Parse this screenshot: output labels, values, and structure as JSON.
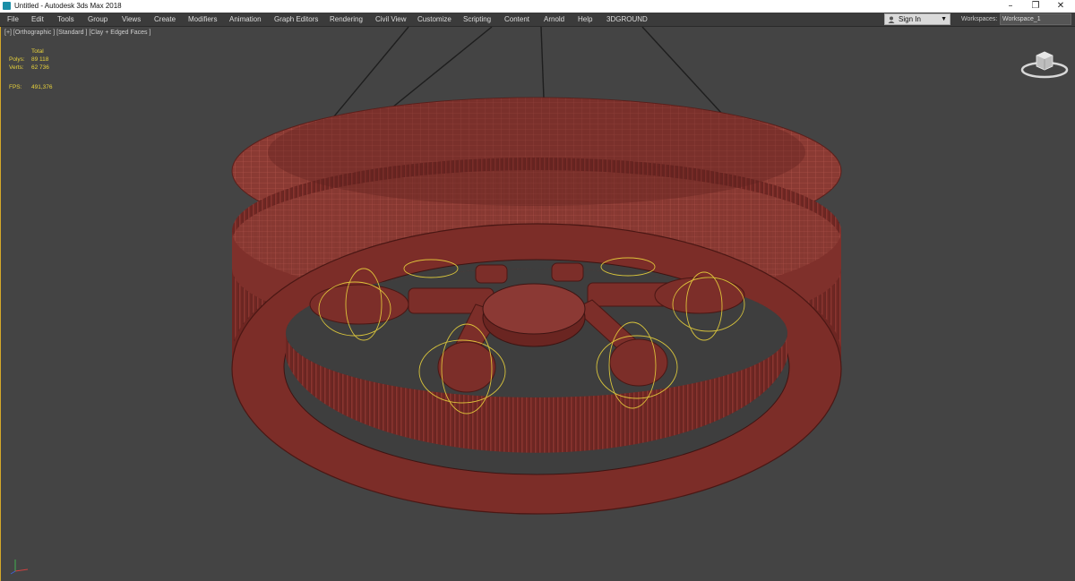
{
  "window": {
    "title": "Untitled - Autodesk 3ds Max 2018",
    "controls": {
      "minimize": "–",
      "maximize": "❐",
      "close": "✕"
    }
  },
  "menu": {
    "items": [
      "File",
      "Edit",
      "Tools",
      "Group",
      "Views",
      "Create",
      "Modifiers",
      "Animation",
      "Graph Editors",
      "Rendering",
      "Civil View",
      "Customize",
      "Scripting",
      "Content",
      "Arnold",
      "Help",
      "3DGROUND"
    ]
  },
  "account": {
    "sign_in_label": "Sign In"
  },
  "workspaces": {
    "label": "Workspaces:",
    "current": "Workspace_1"
  },
  "viewport": {
    "label": "[+] [Orthographic ] [Standard ] [Clay + Edged Faces ]",
    "stats": {
      "header": "Total",
      "polys_label": "Polys:",
      "polys_value": "89 118",
      "verts_label": "Verts:",
      "verts_value": "62 736",
      "fps_label": "FPS:",
      "fps_value": "491,376"
    }
  },
  "colors": {
    "viewport_bg": "#444444",
    "model_fill": "#7a2d28",
    "model_wire": "#a84a42",
    "light_gizmo": "#e8d23c",
    "stats_text": "#e8d23c",
    "active_border": "#d4a82a"
  },
  "icons": {
    "app": "3ds-max-icon",
    "user": "user-icon",
    "dropdown": "chevron-down-icon",
    "viewcube": "viewcube-icon",
    "axis": "axis-tripod-icon"
  }
}
